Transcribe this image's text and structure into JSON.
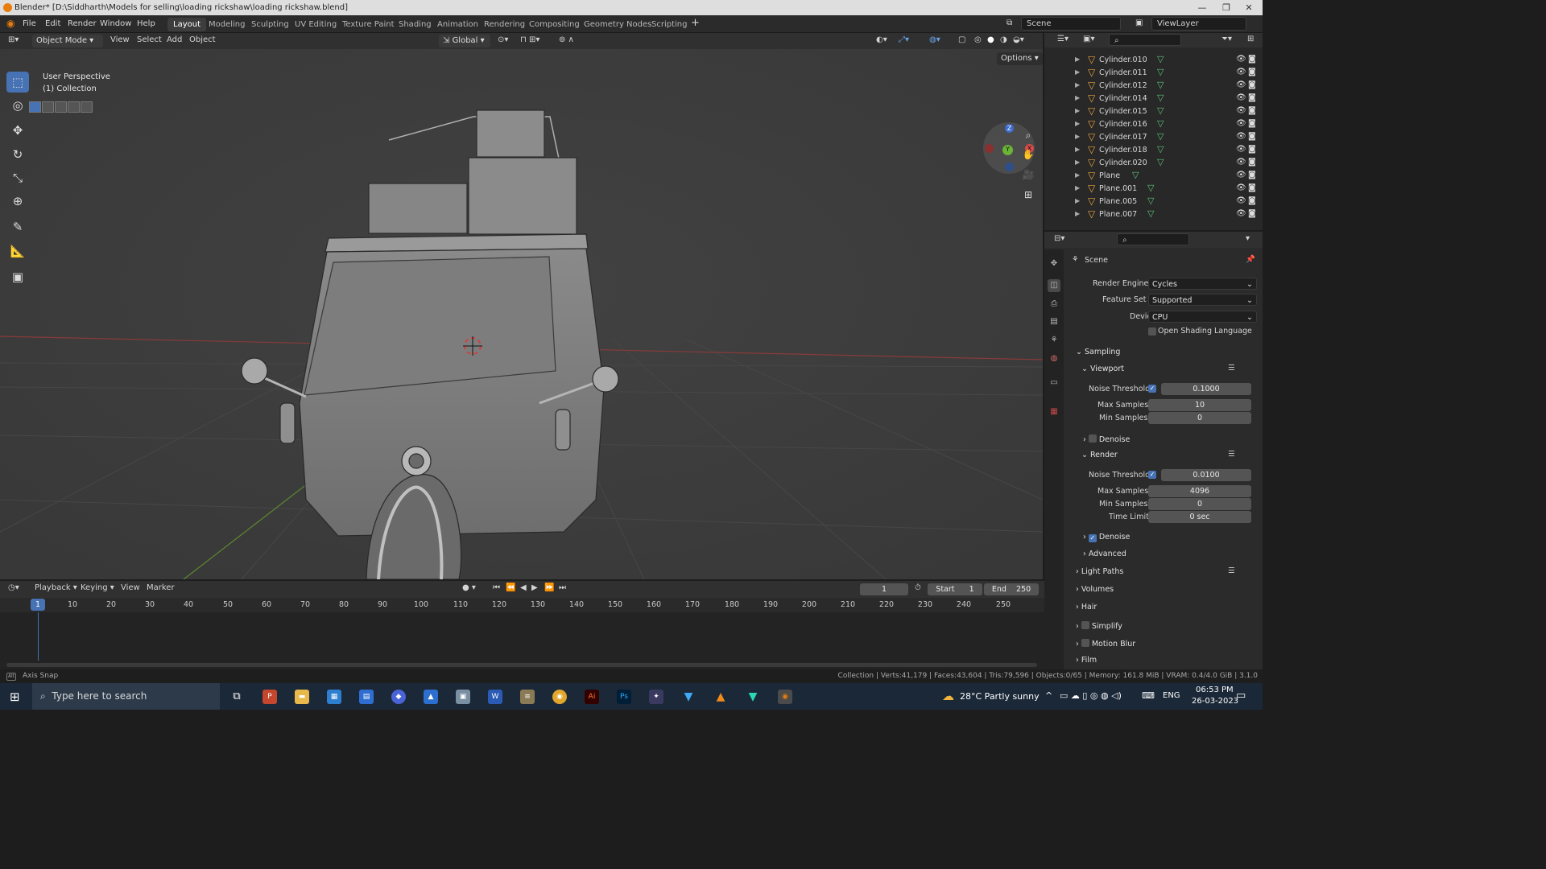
{
  "window": {
    "title": "Blender* [D:\\Siddharth\\Models for selling\\loading rickshaw\\loading rickshaw.blend]",
    "minimize": "—",
    "maximize": "❐",
    "close": "✕"
  },
  "menu": [
    "File",
    "Edit",
    "Render",
    "Window",
    "Help"
  ],
  "workspaces": [
    "Layout",
    "Modeling",
    "Sculpting",
    "UV Editing",
    "Texture Paint",
    "Shading",
    "Animation",
    "Rendering",
    "Compositing",
    "Geometry Nodes",
    "Scripting"
  ],
  "active_workspace": "Layout",
  "scene_field": "Scene",
  "viewlayer_field": "ViewLayer",
  "viewport_header": {
    "mode": "Object Mode",
    "menus": [
      "View",
      "Select",
      "Add",
      "Object"
    ],
    "transform": "Global",
    "options": "Options"
  },
  "viewport": {
    "perspective": "User Perspective",
    "collection": "(1) Collection"
  },
  "gizmo": {
    "z": "Z",
    "y": "Y",
    "x": "X"
  },
  "outliner": {
    "rows": [
      "Cylinder.010",
      "Cylinder.011",
      "Cylinder.012",
      "Cylinder.014",
      "Cylinder.015",
      "Cylinder.016",
      "Cylinder.017",
      "Cylinder.018",
      "Cylinder.020",
      "Plane",
      "Plane.001",
      "Plane.005",
      "Plane.007"
    ]
  },
  "properties": {
    "context": "Scene",
    "render_engine_label": "Render Engine",
    "render_engine": "Cycles",
    "feature_set_label": "Feature Set",
    "feature_set": "Supported",
    "device_label": "Device",
    "device": "CPU",
    "osl": "Open Shading Language",
    "sampling": "Sampling",
    "viewport": "Viewport",
    "vp_noise_label": "Noise Threshold",
    "vp_noise": "0.1000",
    "vp_max_label": "Max Samples",
    "vp_max": "10",
    "vp_min_label": "Min Samples",
    "vp_min": "0",
    "vp_denoise": "Denoise",
    "render": "Render",
    "r_noise_label": "Noise Threshold",
    "r_noise": "0.0100",
    "r_max_label": "Max Samples",
    "r_max": "4096",
    "r_min_label": "Min Samples",
    "r_min": "0",
    "r_time_label": "Time Limit",
    "r_time": "0 sec",
    "r_denoise": "Denoise",
    "advanced": "Advanced",
    "light_paths": "Light Paths",
    "volumes": "Volumes",
    "hair": "Hair",
    "simplify": "Simplify",
    "motion_blur": "Motion Blur",
    "film": "Film"
  },
  "timeline": {
    "menus": [
      "Playback",
      "Keying",
      "View",
      "Marker"
    ],
    "current_frame": "1",
    "start_label": "Start",
    "start": "1",
    "end_label": "End",
    "end": "250",
    "ticks": [
      "10",
      "20",
      "30",
      "40",
      "50",
      "60",
      "70",
      "80",
      "90",
      "100",
      "110",
      "120",
      "130",
      "140",
      "150",
      "160",
      "170",
      "180",
      "190",
      "200",
      "210",
      "220",
      "230",
      "240",
      "250"
    ],
    "playhead": "1"
  },
  "status": {
    "left": "Axis Snap",
    "right": "Collection | Verts:41,179 | Faces:43,604 | Tris:79,596 | Objects:0/65 | Memory: 161.8 MiB | VRAM: 0.4/4.0 GiB | 3.1.0"
  },
  "taskbar": {
    "search": "Type here to search",
    "weather": "28°C  Partly sunny",
    "lang": "ENG",
    "time": "06:53 PM",
    "date": "26-03-2023"
  }
}
